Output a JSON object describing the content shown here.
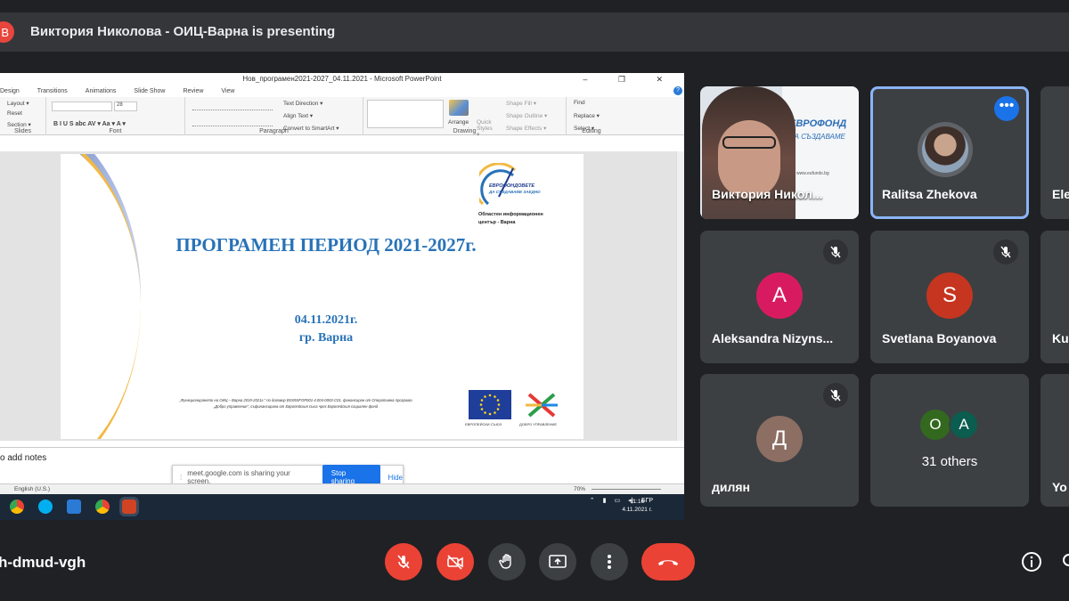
{
  "presenter": {
    "avatar_letter": "В",
    "title": "Виктория Николова - ОИЦ-Варна is presenting"
  },
  "powerpoint": {
    "window_title": "Нов_програмен2021-2027_04.11.2021 - Microsoft PowerPoint",
    "window_buttons": "– ❐ ✕",
    "help": "?",
    "tabs": [
      "Design",
      "Transitions",
      "Animations",
      "Slide Show",
      "Review",
      "View"
    ],
    "ribbon": {
      "slides_items": [
        "Layout ▾",
        "Reset",
        "Section ▾"
      ],
      "slides_label": "Slides",
      "font_size": "28",
      "font_label": "Font",
      "font_buttons": "B  I  U  S  abc  AV ▾  Aa ▾   A ▾",
      "paragraph_items": [
        "Text Direction ▾",
        "Align Text ▾",
        "Convert to SmartArt ▾"
      ],
      "paragraph_label": "Paragraph",
      "arrange": "Arrange",
      "quick_styles": "Quick Styles ▾",
      "shape_items": [
        "Shape Fill ▾",
        "Shape Outline ▾",
        "Shape Effects ▾"
      ],
      "drawing_label": "Drawing",
      "editing_items": [
        "Find",
        "Replace ▾",
        "Select ▾"
      ],
      "editing_label": "Editing"
    },
    "slide": {
      "title": "ПРОГРАМЕН ПЕРИОД 2021-2027г.",
      "date": "04.11.2021г.",
      "city": "гр. Варна",
      "logo_brand": "ЕВРОФОНДОВЕТЕ",
      "logo_tagline": "ДА СЪЗДАВАМЕ ЗАЕДНО",
      "logo_center_line1": "Областен информационен",
      "logo_center_line2": "център - Варна",
      "footer_line1": "„Функционирането на ОИЦ – Варна 2019-2021г.“ по договор BG05SFOP001-4.004-0003-C01, финансиран от Оперативна програма",
      "footer_line2": "„Добро управление“, съфинансирана от Европейския съюз чрез Европейския социален фонд",
      "eu_caption": "ЕВРОПЕЙСКИ СЪЮЗ",
      "gov_caption": "ДОБРО УПРАВЛЕНИЕ"
    },
    "notes_placeholder": "o add notes",
    "status_language": "English (U.S.)",
    "zoom": "70%",
    "taskbar": {
      "lang": "БГР",
      "time": "11:16",
      "date": "4.11.2021 г."
    }
  },
  "sharing_banner": {
    "text": "meet.google.com is sharing your screen.",
    "stop": "Stop sharing",
    "hide": "Hide"
  },
  "participants": [
    {
      "name": "Виктория Никол...",
      "type": "video"
    },
    {
      "name": "Ralitsa Zhekova",
      "type": "photo"
    },
    {
      "name": "Ele",
      "type": "partial"
    },
    {
      "name": "Aleksandra Nizyns...",
      "letter": "A",
      "color": "#d81b60"
    },
    {
      "name": "Svetlana Boyanova",
      "letter": "S",
      "color": "#c5351f"
    },
    {
      "name": "Ku",
      "type": "partial"
    },
    {
      "name": "дилян",
      "letter": "Д",
      "color": "#8d6e63"
    },
    {
      "name": "31 others",
      "letters": [
        "O",
        "A"
      ]
    },
    {
      "name": "Yo",
      "type": "partial"
    }
  ],
  "video_bg_text": {
    "line1": "ЕВРОФОНД",
    "line2": "ДА СЪЗДАВАМЕ",
    "url": "www.eufunds.bg"
  },
  "meeting_code": "h-dmud-vgh",
  "colors": {
    "red": "#ea4335",
    "control_gray": "#3c4043",
    "accent_blue": "#8ab4f8"
  }
}
